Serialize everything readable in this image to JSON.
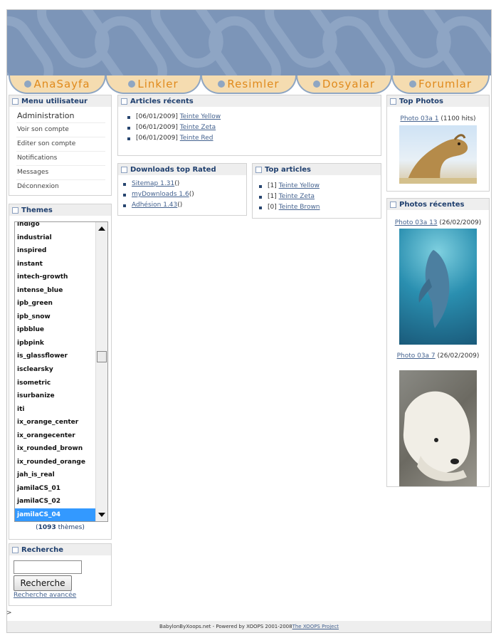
{
  "nav": {
    "tabs": [
      "AnaSayfa",
      "Linkler",
      "Resimler",
      "Dosyalar",
      "Forumlar"
    ]
  },
  "user_menu": {
    "title": "Menu utilisateur",
    "items": [
      "Administration",
      "Voir son compte",
      "Editer son compte",
      "Notifications",
      "Messages",
      "Déconnexion"
    ]
  },
  "themes": {
    "title": "Themes",
    "items": [
      "indigo",
      "industrial",
      "inspired",
      "instant",
      "intech-growth",
      "intense_blue",
      "ipb_green",
      "ipb_snow",
      "ipbblue",
      "ipbpink",
      "is_glassflower",
      "isclearsky",
      "isometric",
      "isurbanize",
      "iti",
      "ix_orange_center",
      "ix_orangecenter",
      "ix_rounded_brown",
      "ix_rounded_orange",
      "jah_is_real",
      "jamilaCS_01",
      "jamilaCS_02",
      "jamilaCS_04"
    ],
    "selected": "jamilaCS_04",
    "count_open": "(",
    "count_num": "1093",
    "count_label": " thèmes)"
  },
  "search": {
    "title": "Recherche",
    "input_value": "",
    "button": "Recherche",
    "advanced": "Recherche avancée"
  },
  "recent_articles": {
    "title": "Articles récents",
    "items": [
      {
        "date": "[06/01/2009]",
        "link": "Teinte Yellow"
      },
      {
        "date": "[06/01/2009]",
        "link": "Teinte Zeta"
      },
      {
        "date": "[06/01/2009]",
        "link": "Teinte Red"
      }
    ]
  },
  "downloads": {
    "title": "Downloads top Rated",
    "items": [
      {
        "link": "Sitemap 1.31",
        "suffix": " ()"
      },
      {
        "link": "myDownloads 1.6",
        "suffix": " ()"
      },
      {
        "link": "Adhésion 1.43",
        "suffix": " ()"
      }
    ]
  },
  "top_articles": {
    "title": "Top articles",
    "items": [
      {
        "rank": "[1]",
        "link": "Teinte Yellow"
      },
      {
        "rank": "[1]",
        "link": "Teinte Zeta"
      },
      {
        "rank": "[0]",
        "link": "Teinte Brown"
      }
    ]
  },
  "top_photos": {
    "title": "Top Photos",
    "caption_link": "Photo 03a 1",
    "caption_extra": " (1100 hits)"
  },
  "recent_photos": {
    "title": "Photos récentes",
    "items": [
      {
        "link": "Photo 03a 13",
        "extra": " (26/02/2009)"
      },
      {
        "link": "Photo 03a 7",
        "extra": " (26/02/2009)"
      }
    ]
  },
  "footer": {
    "text": "BabylonByXoops.net - Powered by XOOPS 2001-2008 ",
    "link": "The XOOPS Project"
  },
  "misc": {
    "corner_mark": ">"
  },
  "colors": {
    "banner": "#7c95b8",
    "tab_fill": "#f5dcb0",
    "tab_text": "#e08a1c",
    "box_title": "#1f3f6e",
    "link": "#44628f",
    "selected": "#3399ff"
  }
}
